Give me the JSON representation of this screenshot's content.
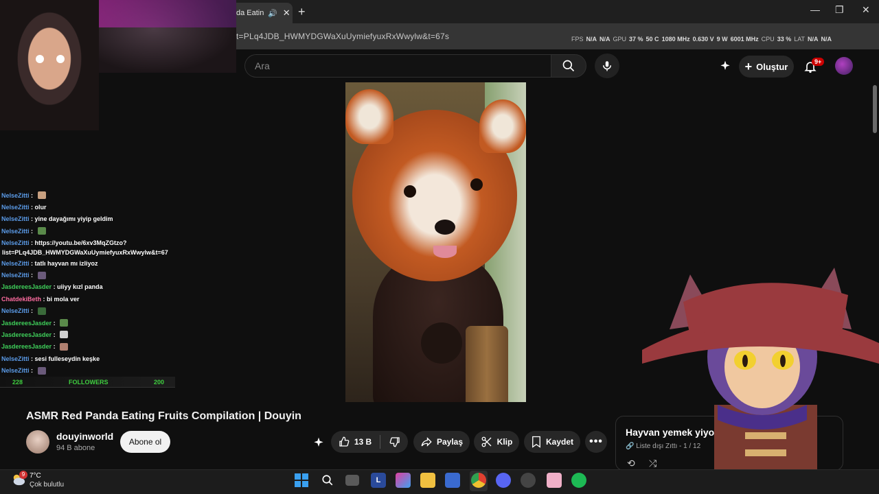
{
  "browser": {
    "tab_title": "da Eating",
    "url": "t=PLq4JDB_HWMYDGWaXuUymiefyuxRxWwylw&t=67s",
    "stats": [
      {
        "label": "FPS",
        "value": "N/A"
      },
      {
        "label": "",
        "value": "N/A"
      },
      {
        "label": "GPU",
        "value": "37 %"
      },
      {
        "label": "",
        "value": "50 C"
      },
      {
        "label": "",
        "value": "1080 MHz"
      },
      {
        "label": "",
        "value": "0.630 V"
      },
      {
        "label": "",
        "value": "9 W"
      },
      {
        "label": "",
        "value": "6001 MHz"
      },
      {
        "label": "CPU",
        "value": "33 %"
      },
      {
        "label": "LAT",
        "value": "N/A"
      },
      {
        "label": "",
        "value": "N/A"
      }
    ]
  },
  "youtube": {
    "search_placeholder": "Ara",
    "create_label": "Oluştur",
    "notif_badge": "9+"
  },
  "chat": {
    "messages": [
      {
        "user": "NelseZitti",
        "text": "",
        "emote": true,
        "color": "blue"
      },
      {
        "user": "NelseZitti",
        "text": "olur",
        "emote": false,
        "color": "blue"
      },
      {
        "user": "NelseZitti",
        "text": "yine dayağımı yiyip geldim",
        "emote": false,
        "color": "blue"
      },
      {
        "user": "NelseZitti",
        "text": "",
        "emote": true,
        "color": "blue"
      },
      {
        "user": "NelseZitti",
        "text": "https://youtu.be/6xv3MqZGtzo?",
        "emote": false,
        "color": "blue"
      },
      {
        "user": "",
        "text": "list=PLq4JDB_HWMYDGWaXuUymiefyuxRxWwylw&t=67",
        "emote": false,
        "color": "blue",
        "wrap": true
      },
      {
        "user": "NelseZitti",
        "text": "tatlı hayvan mı izliyoz",
        "emote": false,
        "color": "blue"
      },
      {
        "user": "NelseZitti",
        "text": "",
        "emote": true,
        "color": "blue"
      },
      {
        "user": "JasdereesJasder",
        "text": "uiiyy kızl panda",
        "emote": false,
        "color": "green"
      },
      {
        "user": "ChatdekiBeth",
        "text": "bi mola ver",
        "emote": false,
        "color": "pink"
      },
      {
        "user": "NelseZitti",
        "text": "",
        "emote": true,
        "color": "blue"
      },
      {
        "user": "JasdereesJasder",
        "text": "",
        "emote": true,
        "color": "green"
      },
      {
        "user": "JasdereesJasder",
        "text": "",
        "emote": true,
        "color": "green"
      },
      {
        "user": "JasdereesJasder",
        "text": "",
        "emote": true,
        "color": "green"
      },
      {
        "user": "NelseZitti",
        "text": "sesi fulleseydin keşke",
        "emote": false,
        "color": "blue"
      },
      {
        "user": "NelseZitti",
        "text": "",
        "emote": true,
        "color": "blue"
      }
    ],
    "followers_current": "228",
    "followers_label": "FOLLOWERS",
    "followers_goal": "200"
  },
  "video": {
    "title": "ASMR Red Panda Eating Fruits Compilation | Douyin",
    "channel_name": "douyinworld",
    "channel_subs": "94 B abone",
    "subscribe_label": "Abone ol",
    "like_count": "13 B",
    "share_label": "Paylaş",
    "clip_label": "Klip",
    "save_label": "Kaydet"
  },
  "playlist": {
    "title": "Hayvan yemek yiyo",
    "meta": "Liste dışı  Zıttı - 1 / 12"
  },
  "taskbar": {
    "temp": "7°C",
    "weather": "Çok bulutlu",
    "weather_badge": "9"
  }
}
